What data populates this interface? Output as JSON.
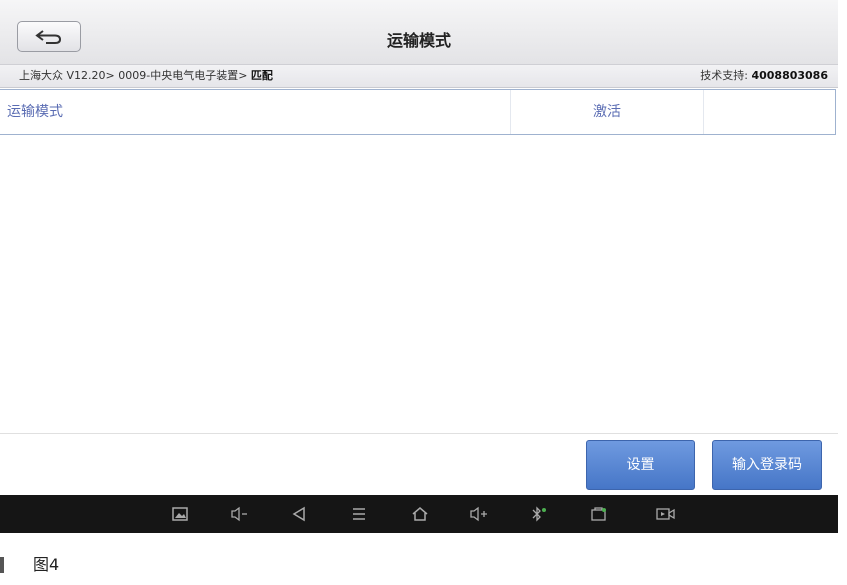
{
  "header": {
    "title": "运输模式",
    "back_icon": "back-arrow-icon"
  },
  "breadcrumb": {
    "path": "上海大众 V12.20> 0009-中央电气电子装置> ",
    "current": "匹配",
    "support_label": "技术支持: ",
    "support_number": "4008803086"
  },
  "table": {
    "rows": [
      {
        "name": "运输模式",
        "value": "激活"
      }
    ]
  },
  "buttons": {
    "settings": "设置",
    "enter_login_code": "输入登录码"
  },
  "navbar": {
    "icons": [
      "gallery-icon",
      "volume-down-icon",
      "back-triangle-icon",
      "menu-icon",
      "home-icon",
      "volume-up-icon",
      "bluetooth-icon",
      "vci-icon",
      "screen-record-icon"
    ]
  },
  "caption": {
    "text": "图4"
  },
  "colors": {
    "button_blue": "#4f7fd0",
    "row_text": "#5a6cb3",
    "navbar": "#151515"
  }
}
